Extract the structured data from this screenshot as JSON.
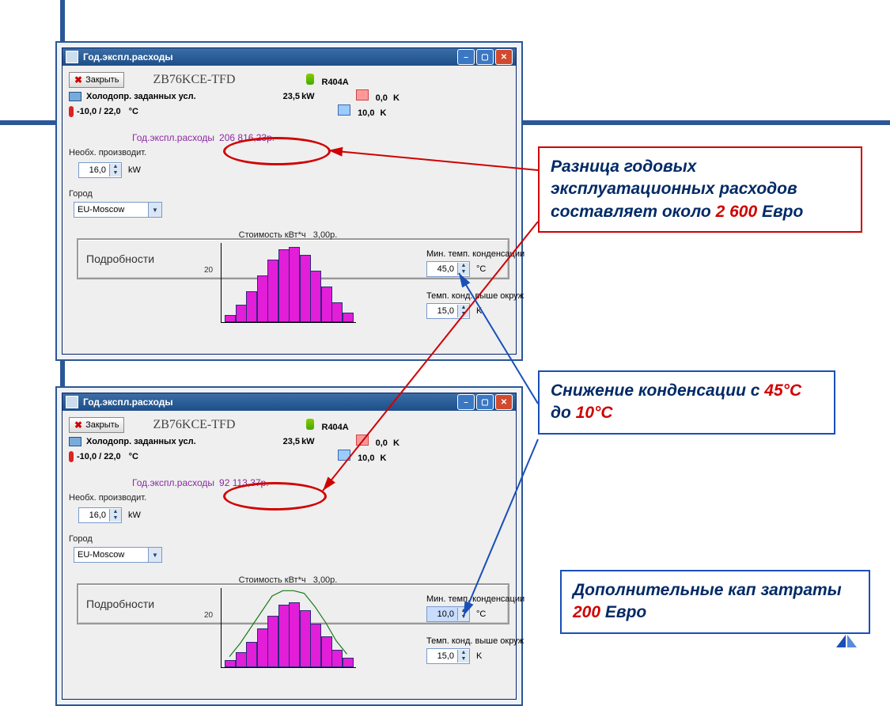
{
  "window_title": "Год.экспл.расходы",
  "close_btn": "Закрыть",
  "model": "ZB76KCE-TFD",
  "refrigerant": "R404A",
  "cooling_conditions_label": "Холодопр. заданных усл.",
  "cooling_value": "23,5",
  "cooling_unit": "kW",
  "temps": "-10,0 / 22,0",
  "temp_unit": "°C",
  "superheat": "0,0",
  "superheat_unit": "K",
  "subcool": "10,0",
  "subcool_unit": "K",
  "annual_label": "Год.экспл.расходы",
  "annual_val_top": "206 816,23р.",
  "annual_val_bot": "92 113,37р.",
  "req_cap_label": "Необх. производит.",
  "req_cap_val": "16,0",
  "req_cap_unit": "kW",
  "city_label": "Город",
  "city_val": "EU-Moscow",
  "price_label": "Стоимость кВт*ч",
  "price_val": "3,00р.",
  "details_btn": "Подробности",
  "min_cond_label": "Мин. темп. конденсации",
  "min_cond_top": "45,0",
  "min_cond_bot": "10,0",
  "min_cond_unit": "°C",
  "delta_label": "Темп. конд. выше окруж",
  "delta_val": "15,0",
  "delta_unit": "K",
  "callouts": {
    "c1a": "Разница годовых эксплуатационных расходов составляет около ",
    "c1b": "2 600",
    "c1c": " Евро",
    "c2a": "Снижение конденсации с ",
    "c2b": "45°С",
    "c2c": " до ",
    "c2d": "10°С",
    "c3a": "Дополнительные кап затраты ",
    "c3b": "200",
    "c3c": " Евро"
  },
  "chart_data": {
    "type": "bar",
    "title": "",
    "xlabel": "",
    "ylabel": "",
    "ylim": [
      0,
      30
    ],
    "y_ticks": [
      20
    ],
    "bars_top": [
      2,
      6,
      11,
      17,
      23,
      27,
      28,
      25,
      19,
      13,
      7,
      3
    ],
    "bars_bot": [
      2,
      5,
      9,
      14,
      19,
      23,
      24,
      21,
      16,
      11,
      6,
      3
    ],
    "envelope_bot": [
      4,
      9,
      15,
      21,
      27,
      29,
      29,
      28,
      23,
      17,
      10,
      5
    ]
  }
}
